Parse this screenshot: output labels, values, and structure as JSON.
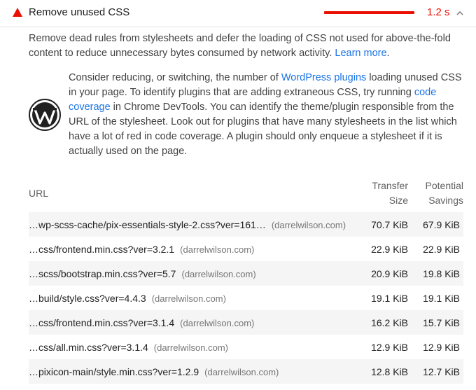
{
  "audit": {
    "title": "Remove unused CSS",
    "value": "1.2 s",
    "severity_color": "#eb0f00",
    "status_icon": "warning-triangle-icon",
    "toggle_icon": "chevron-up-icon"
  },
  "description": {
    "text": "Remove dead rules from stylesheets and defer the loading of CSS not used for above-the-fold content to reduce unnecessary bytes consumed by network activity. ",
    "link_label": "Learn more",
    "trailing": "."
  },
  "stack_pack": {
    "icon": "wordpress-logo-icon",
    "part1": "Consider reducing, or switching, the number of ",
    "link1": "WordPress plugins",
    "part2": " loading unused CSS in your page. To identify plugins that are adding extraneous CSS, try running ",
    "link2": "code coverage",
    "part3": " in Chrome DevTools. You can identify the theme/plugin responsible from the URL of the stylesheet. Look out for plugins that have many stylesheets in the list which have a lot of red in code coverage. A plugin should only enqueue a stylesheet if it is actually used on the page.",
    "link_color": "#1a73e8"
  },
  "table": {
    "headers": {
      "url": "URL",
      "transfer_size_1": "Transfer",
      "transfer_size_2": "Size",
      "savings_1": "Potential",
      "savings_2": "Savings"
    },
    "rows": [
      {
        "url": "…wp-scss-cache/pix-essentials-style-2.css?ver=161…",
        "origin": "(darrelwilson.com)",
        "size": "70.7 KiB",
        "savings": "67.9 KiB"
      },
      {
        "url": "…css/frontend.min.css?ver=3.2.1",
        "origin": "(darrelwilson.com)",
        "size": "22.9 KiB",
        "savings": "22.9 KiB"
      },
      {
        "url": "…scss/bootstrap.min.css?ver=5.7",
        "origin": "(darrelwilson.com)",
        "size": "20.9 KiB",
        "savings": "19.8 KiB"
      },
      {
        "url": "…build/style.css?ver=4.4.3",
        "origin": "(darrelwilson.com)",
        "size": "19.1 KiB",
        "savings": "19.1 KiB"
      },
      {
        "url": "…css/frontend.min.css?ver=3.1.4",
        "origin": "(darrelwilson.com)",
        "size": "16.2 KiB",
        "savings": "15.7 KiB"
      },
      {
        "url": "…css/all.min.css?ver=3.1.4",
        "origin": "(darrelwilson.com)",
        "size": "12.9 KiB",
        "savings": "12.9 KiB"
      },
      {
        "url": "…pixicon-main/style.min.css?ver=1.2.9",
        "origin": "(darrelwilson.com)",
        "size": "12.8 KiB",
        "savings": "12.7 KiB"
      }
    ]
  }
}
